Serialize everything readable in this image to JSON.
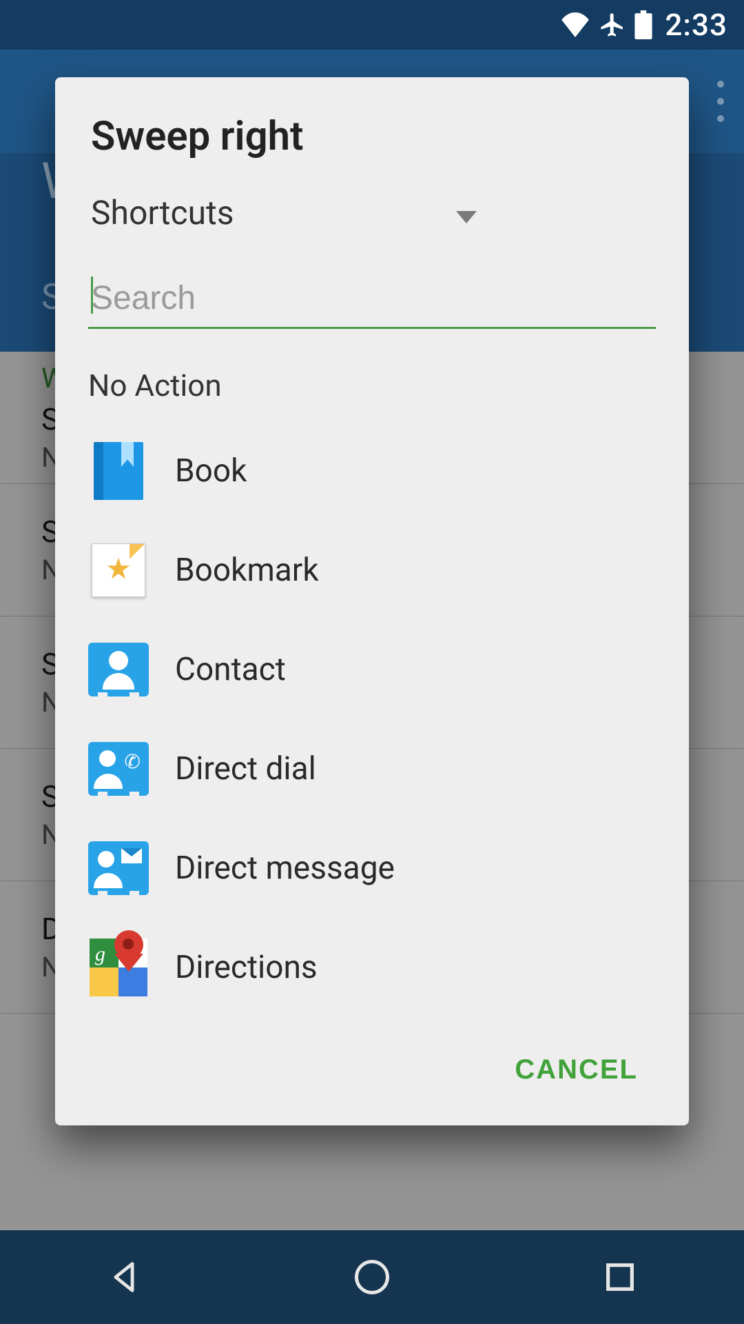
{
  "status": {
    "time": "2:33"
  },
  "background": {
    "title_initial": "W",
    "subtitle_initial": "S",
    "rows": [
      {
        "t1": "W",
        "t2": "S",
        "t3": "N"
      },
      {
        "t1": "",
        "t2": "S",
        "t3": "N"
      },
      {
        "t1": "",
        "t2": "S",
        "t3": "N"
      },
      {
        "t1": "",
        "t2": "S",
        "t3": "N"
      },
      {
        "t1": "",
        "t2": "D",
        "t3": "N"
      }
    ]
  },
  "dialog": {
    "title": "Sweep right",
    "dropdown_label": "Shortcuts",
    "search_placeholder": "Search",
    "no_action_label": "No Action",
    "items": [
      {
        "label": "Book",
        "icon": "book"
      },
      {
        "label": "Bookmark",
        "icon": "bookmark"
      },
      {
        "label": "Contact",
        "icon": "contact"
      },
      {
        "label": "Direct dial",
        "icon": "direct-dial"
      },
      {
        "label": "Direct message",
        "icon": "direct-message"
      },
      {
        "label": "Directions",
        "icon": "directions"
      }
    ],
    "cancel_label": "CANCEL"
  }
}
